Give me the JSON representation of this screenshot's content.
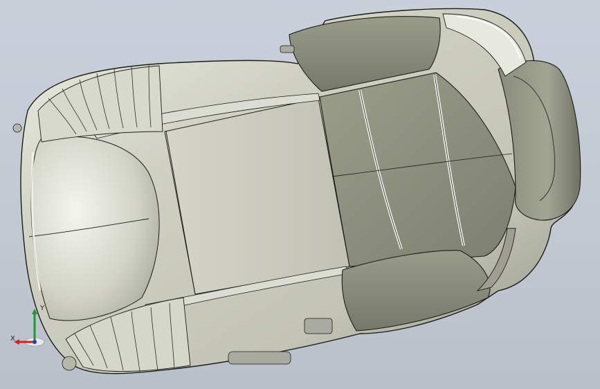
{
  "viewport": {
    "background_top": "#c9d0db",
    "background_bottom": "#b9c0ca"
  },
  "model": {
    "surface_color": "#cfd0c2",
    "shadow_color": "#8d8f82",
    "cushion_color": "#8f9180",
    "edge_color": "#1b1b18",
    "highlight_color": "#f7f7f2"
  },
  "triad": {
    "x_label": "X",
    "y_label": "Y",
    "x_axis_color": "#d42020",
    "y_axis_color": "#1a9a2a",
    "z_axis_color": "#1f3fd0"
  }
}
